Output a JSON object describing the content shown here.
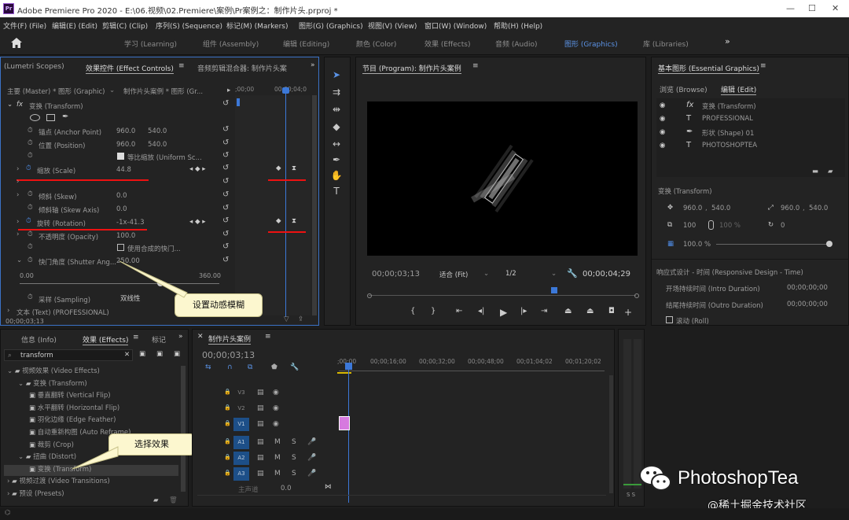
{
  "app": {
    "title": "Adobe Premiere Pro 2020 - E:\\06.视频\\02.Premiere\\案例\\Pr案例之：制作片头.prproj *",
    "logo": "Pr"
  },
  "menu": [
    "文件(F) (File)",
    "编辑(E) (Edit)",
    "剪辑(C) (Clip)",
    "序列(S) (Sequence)",
    "标记(M) (Markers)",
    "图形(G) (Graphics)",
    "视图(V) (View)",
    "窗口(W) (Window)",
    "帮助(H) (Help)"
  ],
  "workspaces": [
    "学习 (Learning)",
    "组件 (Assembly)",
    "编辑 (Editing)",
    "颜色 (Color)",
    "效果 (Effects)",
    "音频 (Audio)",
    "图形 (Graphics)",
    "库 (Libraries)"
  ],
  "workspace_active": "图形 (Graphics)",
  "effect_controls": {
    "tab_lumetri": "(Lumetri Scopes)",
    "tab_active": "效果控件 (Effect Controls)",
    "tab_mixer": "音频剪辑混合器: 制作片头案",
    "master": "主要 (Master) * 图形 (Graphic)",
    "clip": "制作片头案例 * 图形 (Gr...",
    "ruler_start": ";00;00",
    "ruler_end": "00;00;04;0",
    "fx_transform": "变换 (Transform)",
    "anchor_label": "锚点 (Anchor Point)",
    "anchor_x": "960.0",
    "anchor_y": "540.0",
    "position_label": "位置 (Position)",
    "position_x": "960.0",
    "position_y": "540.0",
    "uniform_label": "等比缩放 (Uniform Sc...",
    "scale_label": "缩放 (Scale)",
    "scale_value": "44.8",
    "skew_label": "倾斜 (Skew)",
    "skew_value": "0.0",
    "skew_axis_label": "倾斜轴 (Skew Axis)",
    "skew_axis_value": "0.0",
    "rotation_label": "旋转 (Rotation)",
    "rotation_value": "-1x-41.3",
    "opacity_label": "不透明度 (Opacity)",
    "opacity_value": "100.0",
    "use_comp_label": "使用合成的快门...",
    "shutter_label": "快门角度 (Shutter Ang...",
    "shutter_value": "250.00",
    "slider_min": "0.00",
    "slider_max": "360.00",
    "sampling_label": "采样 (Sampling)",
    "sampling_value": "双线性",
    "text_row": "文本 (Text) (PROFESSIONAL)",
    "timecode": "00;00;03;13"
  },
  "callouts": {
    "motion_blur": "设置动感模糊",
    "select_effect": "选择效果"
  },
  "program": {
    "title": "节目 (Program): 制作片头案例",
    "timecode": "00;00;03;13",
    "fit": "适合 (Fit)",
    "res": "1/2",
    "duration": "00;00;04;29"
  },
  "essential_graphics": {
    "title": "基本图形 (Essential Graphics)",
    "tab_browse": "浏览 (Browse)",
    "tab_edit": "编辑 (Edit)",
    "layers": [
      {
        "icon": "fx",
        "label": "变换 (Transform)"
      },
      {
        "icon": "T",
        "label": "PROFESSIONAL"
      },
      {
        "icon": "pen",
        "label": "形状 (Shape) 01"
      },
      {
        "icon": "T",
        "label": "PHOTOSHOPTEA"
      }
    ],
    "transform_title": "变换 (Transform)",
    "pos_x": "960.0",
    "pos_y": "540.0",
    "anchor_x": "960.0",
    "anchor_y": "540.0",
    "scale": "100",
    "pct": "100 %",
    "rotation": "0",
    "opacity": "100.0 %",
    "responsive": "响应式设计 - 时间 (Responsive Design - Time)",
    "intro_label": "开场持续时间 (Intro Duration)",
    "intro_value": "00;00;00;00",
    "outro_label": "结尾持续时间 (Outro Duration)",
    "outro_value": "00;00;00;00",
    "roll": "滚动 (Roll)"
  },
  "effects_panel": {
    "tab_info": "信息 (Info)",
    "tab_effects": "效果 (Effects)",
    "tab_markers": "标记",
    "search": "transform",
    "tree": [
      {
        "level": 0,
        "kind": "folder",
        "label": "视频效果 (Video Effects)"
      },
      {
        "level": 1,
        "kind": "folder",
        "label": "变换 (Transform)"
      },
      {
        "level": 2,
        "kind": "fx",
        "label": "垂直翻转 (Vertical Flip)"
      },
      {
        "level": 2,
        "kind": "fx",
        "label": "水平翻转 (Horizontal Flip)"
      },
      {
        "level": 2,
        "kind": "fx",
        "label": "羽化边缘 (Edge Feather)"
      },
      {
        "level": 2,
        "kind": "fx",
        "label": "自动重新构图 (Auto Reframe)"
      },
      {
        "level": 2,
        "kind": "fx",
        "label": "裁剪 (Crop)"
      },
      {
        "level": 1,
        "kind": "folder",
        "label": "扭曲 (Distort)"
      },
      {
        "level": 2,
        "kind": "fx",
        "label": "变换 (Transform)"
      },
      {
        "level": 0,
        "kind": "folder",
        "label": "视频过渡 (Video Transitions)"
      },
      {
        "level": 0,
        "kind": "folder",
        "label": "预设 (Presets)"
      }
    ]
  },
  "timeline": {
    "tab": "制作片头案例",
    "timecode": "00;00;03;13",
    "ruler": [
      ";00;00",
      "00;00;16;00",
      "00;00;32;00",
      "00;00;48;00",
      "00;01;04;02",
      "00;01;20;02"
    ],
    "video_tracks": [
      "V3",
      "V2",
      "V1"
    ],
    "audio_tracks": [
      "A1",
      "A2",
      "A3"
    ],
    "master": "主声道",
    "master_value": "0.0"
  },
  "meter_label": "S S",
  "watermark": {
    "brand": "PhotoshopTea",
    "site": "@稀土掘金技术社区"
  }
}
